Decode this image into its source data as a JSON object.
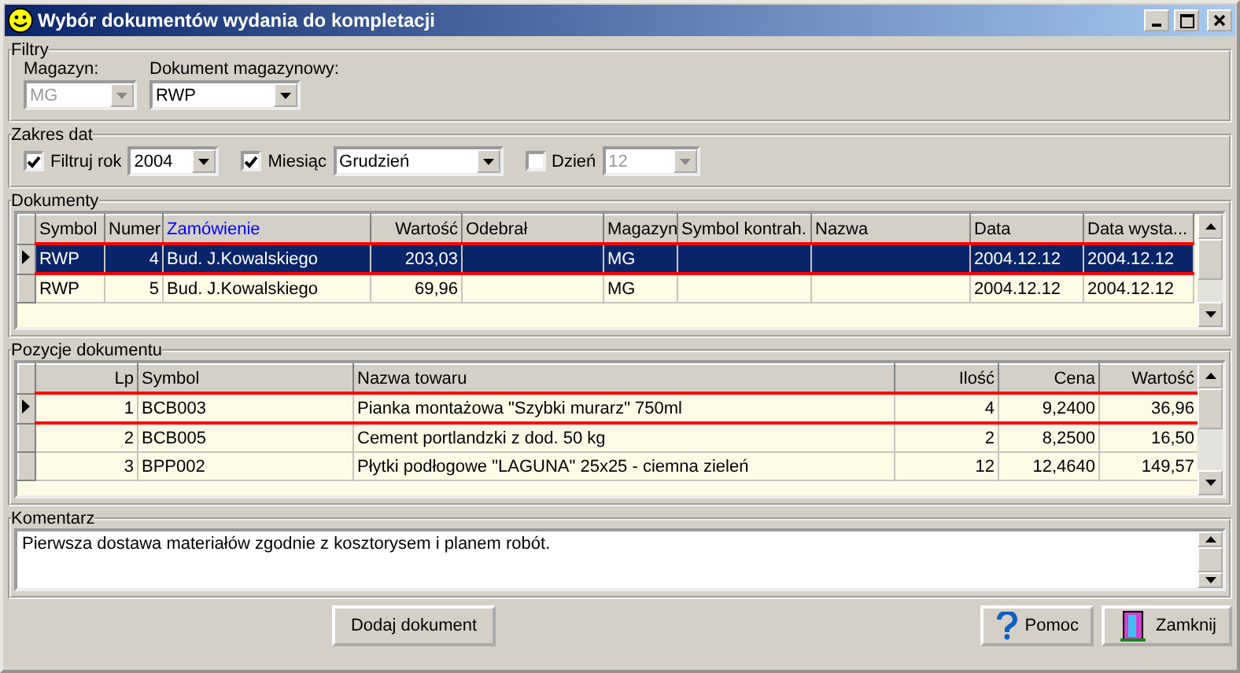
{
  "window": {
    "title": "Wybór dokumentów wydania do kompletacji"
  },
  "filters": {
    "title": "Filtry",
    "warehouse": {
      "label": "Magazyn:",
      "value": "MG",
      "disabled": true
    },
    "document": {
      "label": "Dokument magazynowy:",
      "value": "RWP",
      "disabled": false
    }
  },
  "date_range": {
    "title": "Zakres dat",
    "year": {
      "label": "Filtruj rok",
      "checked": true,
      "value": "2004",
      "disabled": false
    },
    "month": {
      "label": "Miesiąc",
      "checked": true,
      "value": "Grudzień",
      "disabled": false
    },
    "day": {
      "label": "Dzień",
      "checked": false,
      "value": "12",
      "disabled": true
    }
  },
  "documents": {
    "title": "Dokumenty",
    "columns": [
      {
        "label": "Symbol",
        "kind": "text",
        "active": false
      },
      {
        "label": "Numer",
        "kind": "number",
        "active": false
      },
      {
        "label": "Zamówienie",
        "kind": "text",
        "active": true
      },
      {
        "label": "Wartość",
        "kind": "number",
        "active": false
      },
      {
        "label": "Odebrał",
        "kind": "text",
        "active": false
      },
      {
        "label": "Magazyn",
        "kind": "text",
        "active": false
      },
      {
        "label": "Symbol kontrah.",
        "kind": "text",
        "active": false
      },
      {
        "label": "Nazwa",
        "kind": "text",
        "active": false
      },
      {
        "label": "Data",
        "kind": "text",
        "active": false
      },
      {
        "label": "Data wysta...",
        "kind": "text",
        "active": false
      }
    ],
    "rows": [
      {
        "selected": true,
        "cells": [
          "RWP",
          "4",
          "Bud. J.Kowalskiego",
          "203,03",
          "",
          "MG",
          "",
          "",
          "2004.12.12",
          "2004.12.12"
        ]
      },
      {
        "selected": false,
        "cells": [
          "RWP",
          "5",
          "Bud. J.Kowalskiego",
          "69,96",
          "",
          "MG",
          "",
          "",
          "2004.12.12",
          "2004.12.12"
        ]
      }
    ]
  },
  "positions": {
    "title": "Pozycje dokumentu",
    "columns": [
      {
        "label": "Lp",
        "kind": "number",
        "active": false
      },
      {
        "label": "Symbol",
        "kind": "text",
        "active": false
      },
      {
        "label": "Nazwa towaru",
        "kind": "text",
        "active": false
      },
      {
        "label": "Ilość",
        "kind": "number",
        "active": false
      },
      {
        "label": "Cena",
        "kind": "number",
        "active": false
      },
      {
        "label": "Wartość",
        "kind": "number",
        "active": false
      }
    ],
    "rows": [
      {
        "selected": true,
        "cells": [
          "1",
          "BCB003",
          "Pianka montażowa \"Szybki murarz\" 750ml",
          "4",
          "9,2400",
          "36,96"
        ]
      },
      {
        "selected": false,
        "cells": [
          "2",
          "BCB005",
          "Cement portlandzki z dod. 50 kg",
          "2",
          "8,2500",
          "16,50"
        ]
      },
      {
        "selected": false,
        "cells": [
          "3",
          "BPP002",
          "Płytki podłogowe \"LAGUNA\" 25x25 - ciemna zieleń",
          "12",
          "12,4640",
          "149,57"
        ]
      }
    ]
  },
  "comment": {
    "title": "Komentarz",
    "text": "Pierwsza dostawa materiałów zgodnie z kosztorysem i planem robót."
  },
  "buttons": [
    {
      "kind": "add",
      "label": "Dodaj dokument"
    },
    {
      "kind": "help",
      "label": "Pomoc"
    },
    {
      "kind": "close",
      "label": "Zamknij"
    }
  ]
}
